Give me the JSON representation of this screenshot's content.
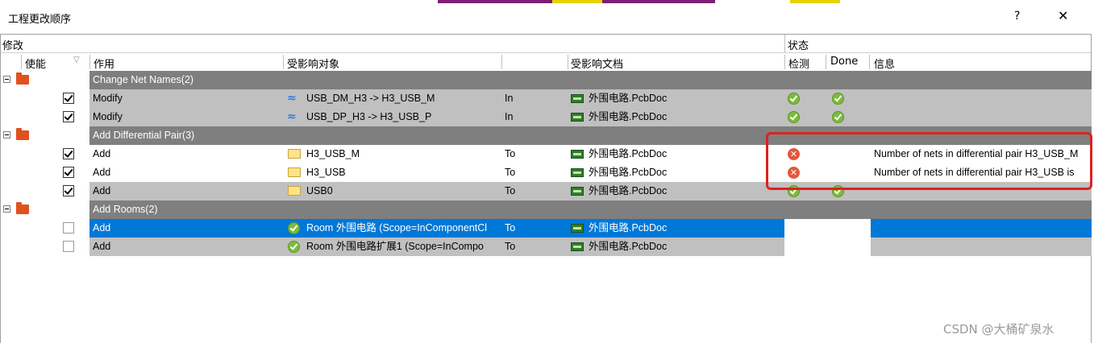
{
  "window": {
    "title": "工程更改顺序",
    "help_label": "?",
    "close_label": "✕"
  },
  "header": {
    "group_modify": "修改",
    "group_status": "状态",
    "col_enable": "使能",
    "sort_glyph": "▽",
    "col_action": "作用",
    "col_affected_object": "受影响对象",
    "col_affected_doc": "受影响文档",
    "col_check": "检测",
    "col_done": "Done",
    "col_info": "信息"
  },
  "groups": [
    {
      "label": "Change Net Names(2)"
    },
    {
      "label": "Add Differential Pair(3)"
    },
    {
      "label": "Add Rooms(2)"
    }
  ],
  "rows": [
    {
      "enabled": true,
      "action": "Modify",
      "object": "USB_DM_H3 -> H3_USB_M",
      "dir": "In",
      "doc": "外围电路.PcbDoc",
      "check": "ok",
      "done": "ok",
      "info": ""
    },
    {
      "enabled": true,
      "action": "Modify",
      "object": "USB_DP_H3 -> H3_USB_P",
      "dir": "In",
      "doc": "外围电路.PcbDoc",
      "check": "ok",
      "done": "ok",
      "info": ""
    },
    {
      "enabled": true,
      "action": "Add",
      "object": "H3_USB_M",
      "dir": "To",
      "doc": "外围电路.PcbDoc",
      "check": "err",
      "done": "",
      "info": "Number of nets in differential pair H3_USB_M"
    },
    {
      "enabled": true,
      "action": "Add",
      "object": "H3_USB",
      "dir": "To",
      "doc": "外围电路.PcbDoc",
      "check": "err",
      "done": "",
      "info": "Number of nets in differential pair H3_USB is"
    },
    {
      "enabled": true,
      "action": "Add",
      "object": "USB0",
      "dir": "To",
      "doc": "外围电路.PcbDoc",
      "check": "ok",
      "done": "ok",
      "info": ""
    },
    {
      "enabled": false,
      "action": "Add",
      "object": "Room 外围电路 (Scope=InComponentCl",
      "dir": "To",
      "doc": "外围电路.PcbDoc",
      "check": "",
      "done": "",
      "info": ""
    },
    {
      "enabled": false,
      "action": "Add",
      "object": "Room 外围电路扩展1 (Scope=InCompo",
      "dir": "To",
      "doc": "外围电路.PcbDoc",
      "check": "",
      "done": "",
      "info": ""
    }
  ],
  "watermark": "CSDN @大桶矿泉水",
  "colors": {
    "group_band": "#7f7f7f",
    "row_gray": "#c0c0c0",
    "selected": "#0078d7",
    "highlight_box": "#e02020"
  }
}
